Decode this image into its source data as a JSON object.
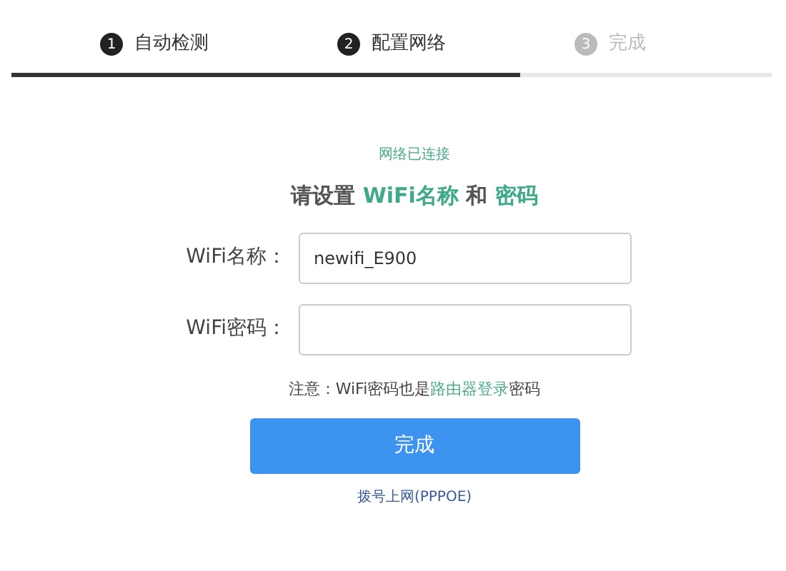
{
  "steps": [
    {
      "number": "1",
      "label": "自动检测",
      "reached": true
    },
    {
      "number": "2",
      "label": "配置网络",
      "reached": true
    },
    {
      "number": "3",
      "label": "完成",
      "reached": false
    }
  ],
  "progress": {
    "level": 0.67
  },
  "status": "网络已连接",
  "heading": [
    {
      "text": "请设置 ",
      "kind": "plain"
    },
    {
      "text": "WiFi名称",
      "kind": "accent"
    },
    {
      "text": " 和 ",
      "kind": "plain"
    },
    {
      "text": "密码",
      "kind": "accent"
    }
  ],
  "fields": [
    {
      "label": "WiFi名称：",
      "value": "newifi_E900"
    },
    {
      "label": "WiFi密码："
    }
  ],
  "note": [
    {
      "text": "注意：WiFi密码也是",
      "kind": "plain"
    },
    {
      "text": "路由器登录",
      "kind": "link"
    },
    {
      "text": "密码",
      "kind": "plain"
    }
  ],
  "submit_button": "完成",
  "pppoe_link": "拨号上网(PPPOE)"
}
